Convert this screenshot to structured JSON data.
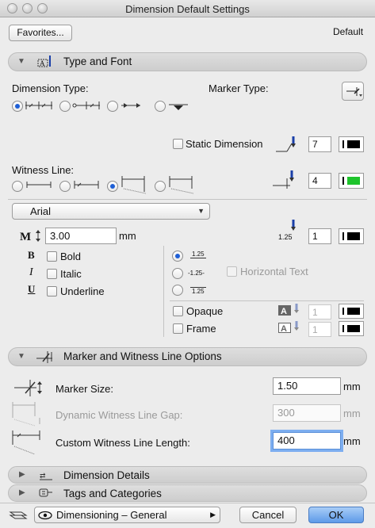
{
  "window": {
    "title": "Dimension Default Settings"
  },
  "top": {
    "favorites_label": "Favorites...",
    "default_label": "Default"
  },
  "sections": {
    "type_font": "Type and Font",
    "marker_witness": "Marker and Witness Line Options",
    "dimension_details": "Dimension Details",
    "tags_categories": "Tags and Categories"
  },
  "type_font": {
    "dimension_type_label": "Dimension Type:",
    "marker_type_label": "Marker Type:",
    "static_dimension_label": "Static Dimension",
    "static_pen": "7",
    "witness_line_label": "Witness Line:",
    "witness_pen": "4",
    "font_name": "Arial",
    "font_size": "3.00",
    "font_unit": "mm",
    "text_pen": "1",
    "bold_label": "Bold",
    "italic_label": "Italic",
    "underline_label": "Underline",
    "pos_above": "1.25",
    "pos_middle": "-1.25-",
    "pos_below": "1.25",
    "horizontal_text_label": "Horizontal Text",
    "opaque_label": "Opaque",
    "opaque_pen": "1",
    "frame_label": "Frame",
    "frame_pen": "1",
    "pen_icon_number": "1.25",
    "swatch_colors": {
      "black": "#000000",
      "green": "#1ec42c"
    }
  },
  "marker_witness": {
    "marker_size_label": "Marker Size:",
    "marker_size_value": "1.50",
    "gap_label": "Dynamic Witness Line Gap:",
    "gap_value": "300",
    "custom_length_label": "Custom Witness Line Length:",
    "custom_length_value": "400",
    "unit": "mm"
  },
  "bottom": {
    "view_label": "Dimensioning – General",
    "cancel_label": "Cancel",
    "ok_label": "OK"
  }
}
